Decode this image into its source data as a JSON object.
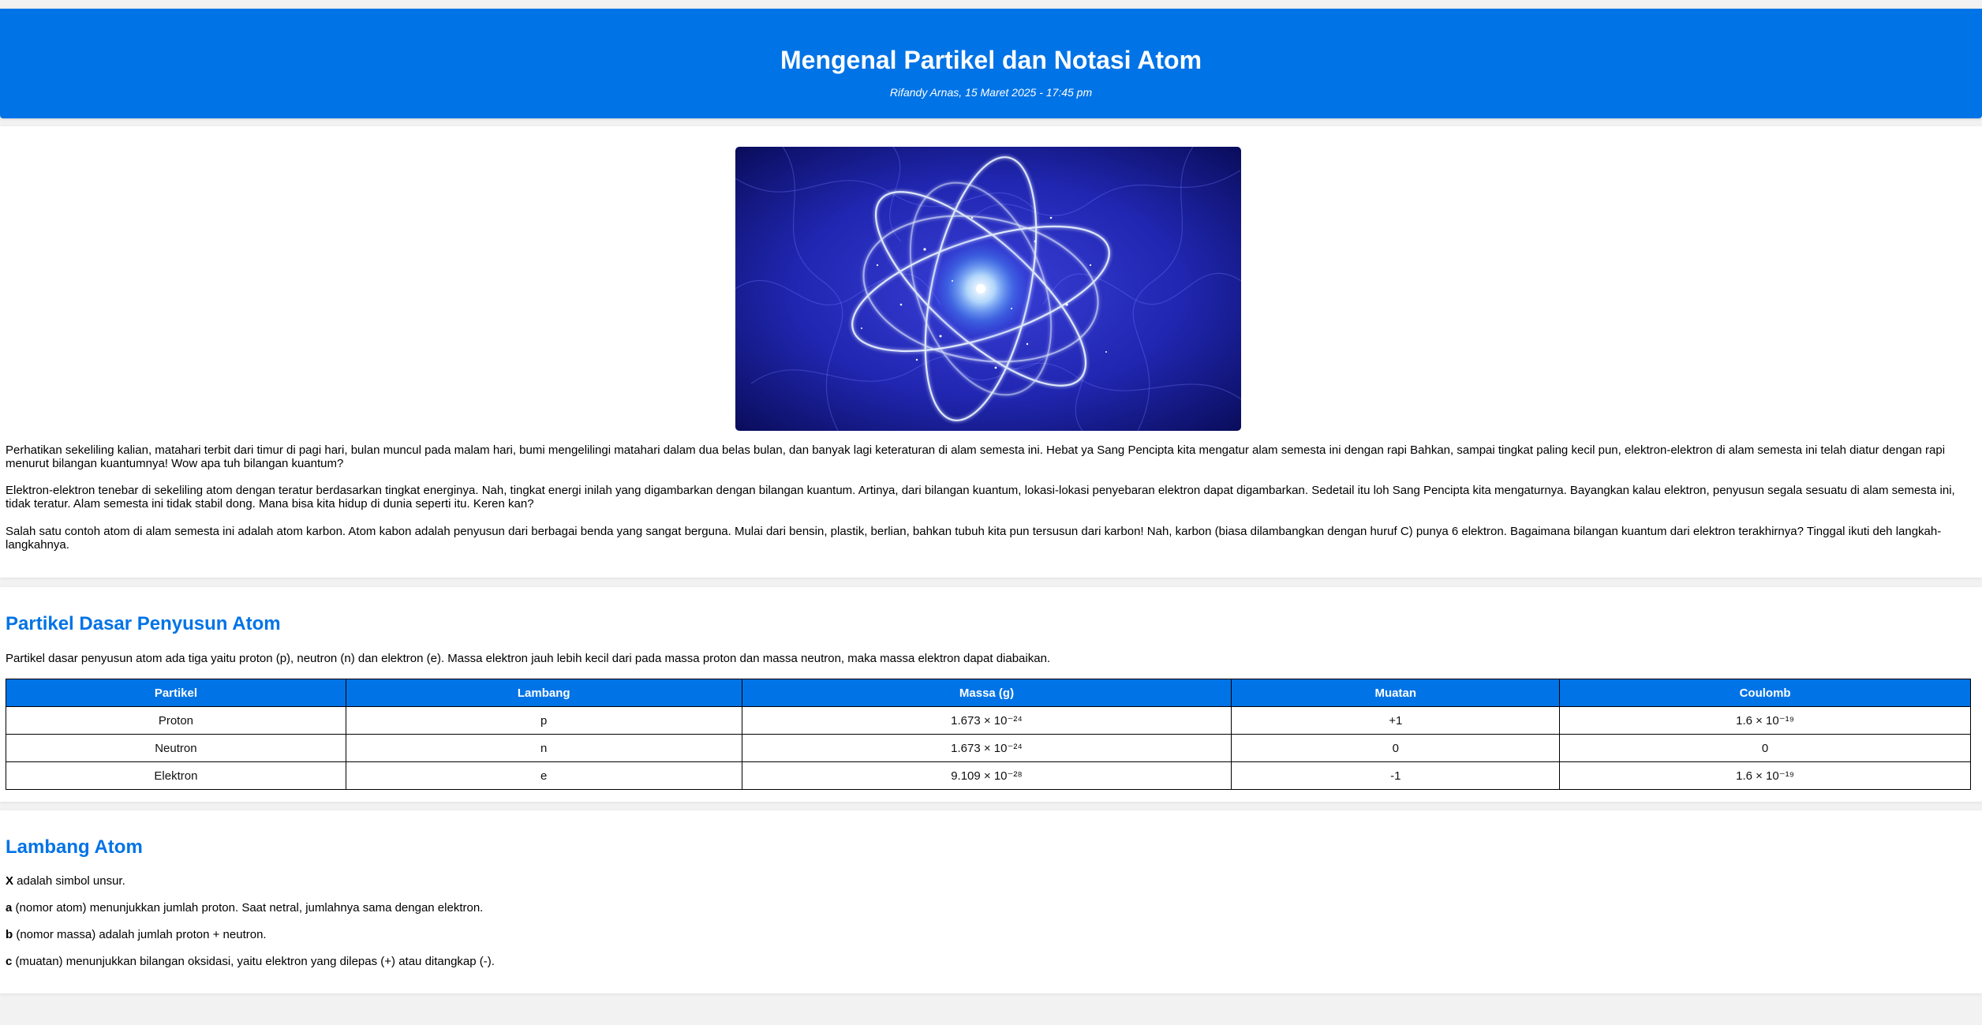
{
  "header": {
    "title": "Mengenal Partikel dan Notasi Atom",
    "byline": "Rifandy Arnas, 15 Maret 2025 - 17:45 pm"
  },
  "intro": {
    "image_label": "atom-illustration",
    "paragraphs": [
      "Perhatikan sekeliling kalian, matahari terbit dari timur di pagi hari, bulan muncul pada malam hari, bumi mengelilingi matahari dalam dua belas bulan, dan banyak lagi keteraturan di alam semesta ini. Hebat ya Sang Pencipta kita mengatur alam semesta ini dengan rapi Bahkan, sampai tingkat paling kecil pun, elektron-elektron di alam semesta ini telah diatur dengan rapi menurut bilangan kuantumnya! Wow apa tuh bilangan kuantum?",
      "Elektron-elektron tenebar di sekeliling atom dengan teratur berdasarkan tingkat energinya. Nah, tingkat energi inilah yang digambarkan dengan bilangan kuantum. Artinya, dari bilangan kuantum, lokasi-lokasi penyebaran elektron dapat digambarkan. Sedetail itu loh Sang Pencipta kita mengaturnya. Bayangkan kalau elektron, penyusun segala sesuatu di alam semesta ini, tidak teratur. Alam semesta ini tidak stabil dong. Mana bisa kita hidup di dunia seperti itu. Keren kan?",
      "Salah satu contoh atom di alam semesta ini adalah atom karbon. Atom kabon adalah penyusun dari berbagai benda yang sangat berguna. Mulai dari bensin, plastik, berlian, bahkan tubuh kita pun tersusun dari karbon! Nah, karbon (biasa dilambangkan dengan huruf C) punya 6 elektron. Bagaimana bilangan kuantum dari elektron terakhirnya? Tinggal ikuti deh langkah-langkahnya."
    ]
  },
  "particles": {
    "title": "Partikel Dasar Penyusun Atom",
    "description": "Partikel dasar penyusun atom ada tiga yaitu proton (p), neutron (n) dan elektron (e). Massa elektron jauh lebih kecil dari pada massa proton dan massa neutron, maka massa elektron dapat diabaikan.",
    "columns": [
      "Partikel",
      "Lambang",
      "Massa (g)",
      "Muatan",
      "Coulomb"
    ],
    "rows": [
      [
        "Proton",
        "p",
        "1.673 × 10⁻²⁴",
        "+1",
        "1.6 × 10⁻¹⁹"
      ],
      [
        "Neutron",
        "n",
        "1.673 × 10⁻²⁴",
        "0",
        "0"
      ],
      [
        "Elektron",
        "e",
        "9.109 × 10⁻²⁸",
        "-1",
        "1.6 × 10⁻¹⁹"
      ]
    ]
  },
  "symbol": {
    "title": "Lambang Atom",
    "items": [
      {
        "term": "X",
        "text": " adalah simbol unsur."
      },
      {
        "term": "a",
        "text": " (nomor atom) menunjukkan jumlah proton. Saat netral, jumlahnya sama dengan elektron."
      },
      {
        "term": "b",
        "text": " (nomor massa) adalah jumlah proton + neutron."
      },
      {
        "term": "c",
        "text": " (muatan) menunjukkan bilangan oksidasi, yaitu elektron yang dilepas (+) atau ditangkap (-)."
      }
    ]
  },
  "colors": {
    "accent": "#0073e6",
    "background": "#f2f2f2",
    "card": "#ffffff"
  }
}
